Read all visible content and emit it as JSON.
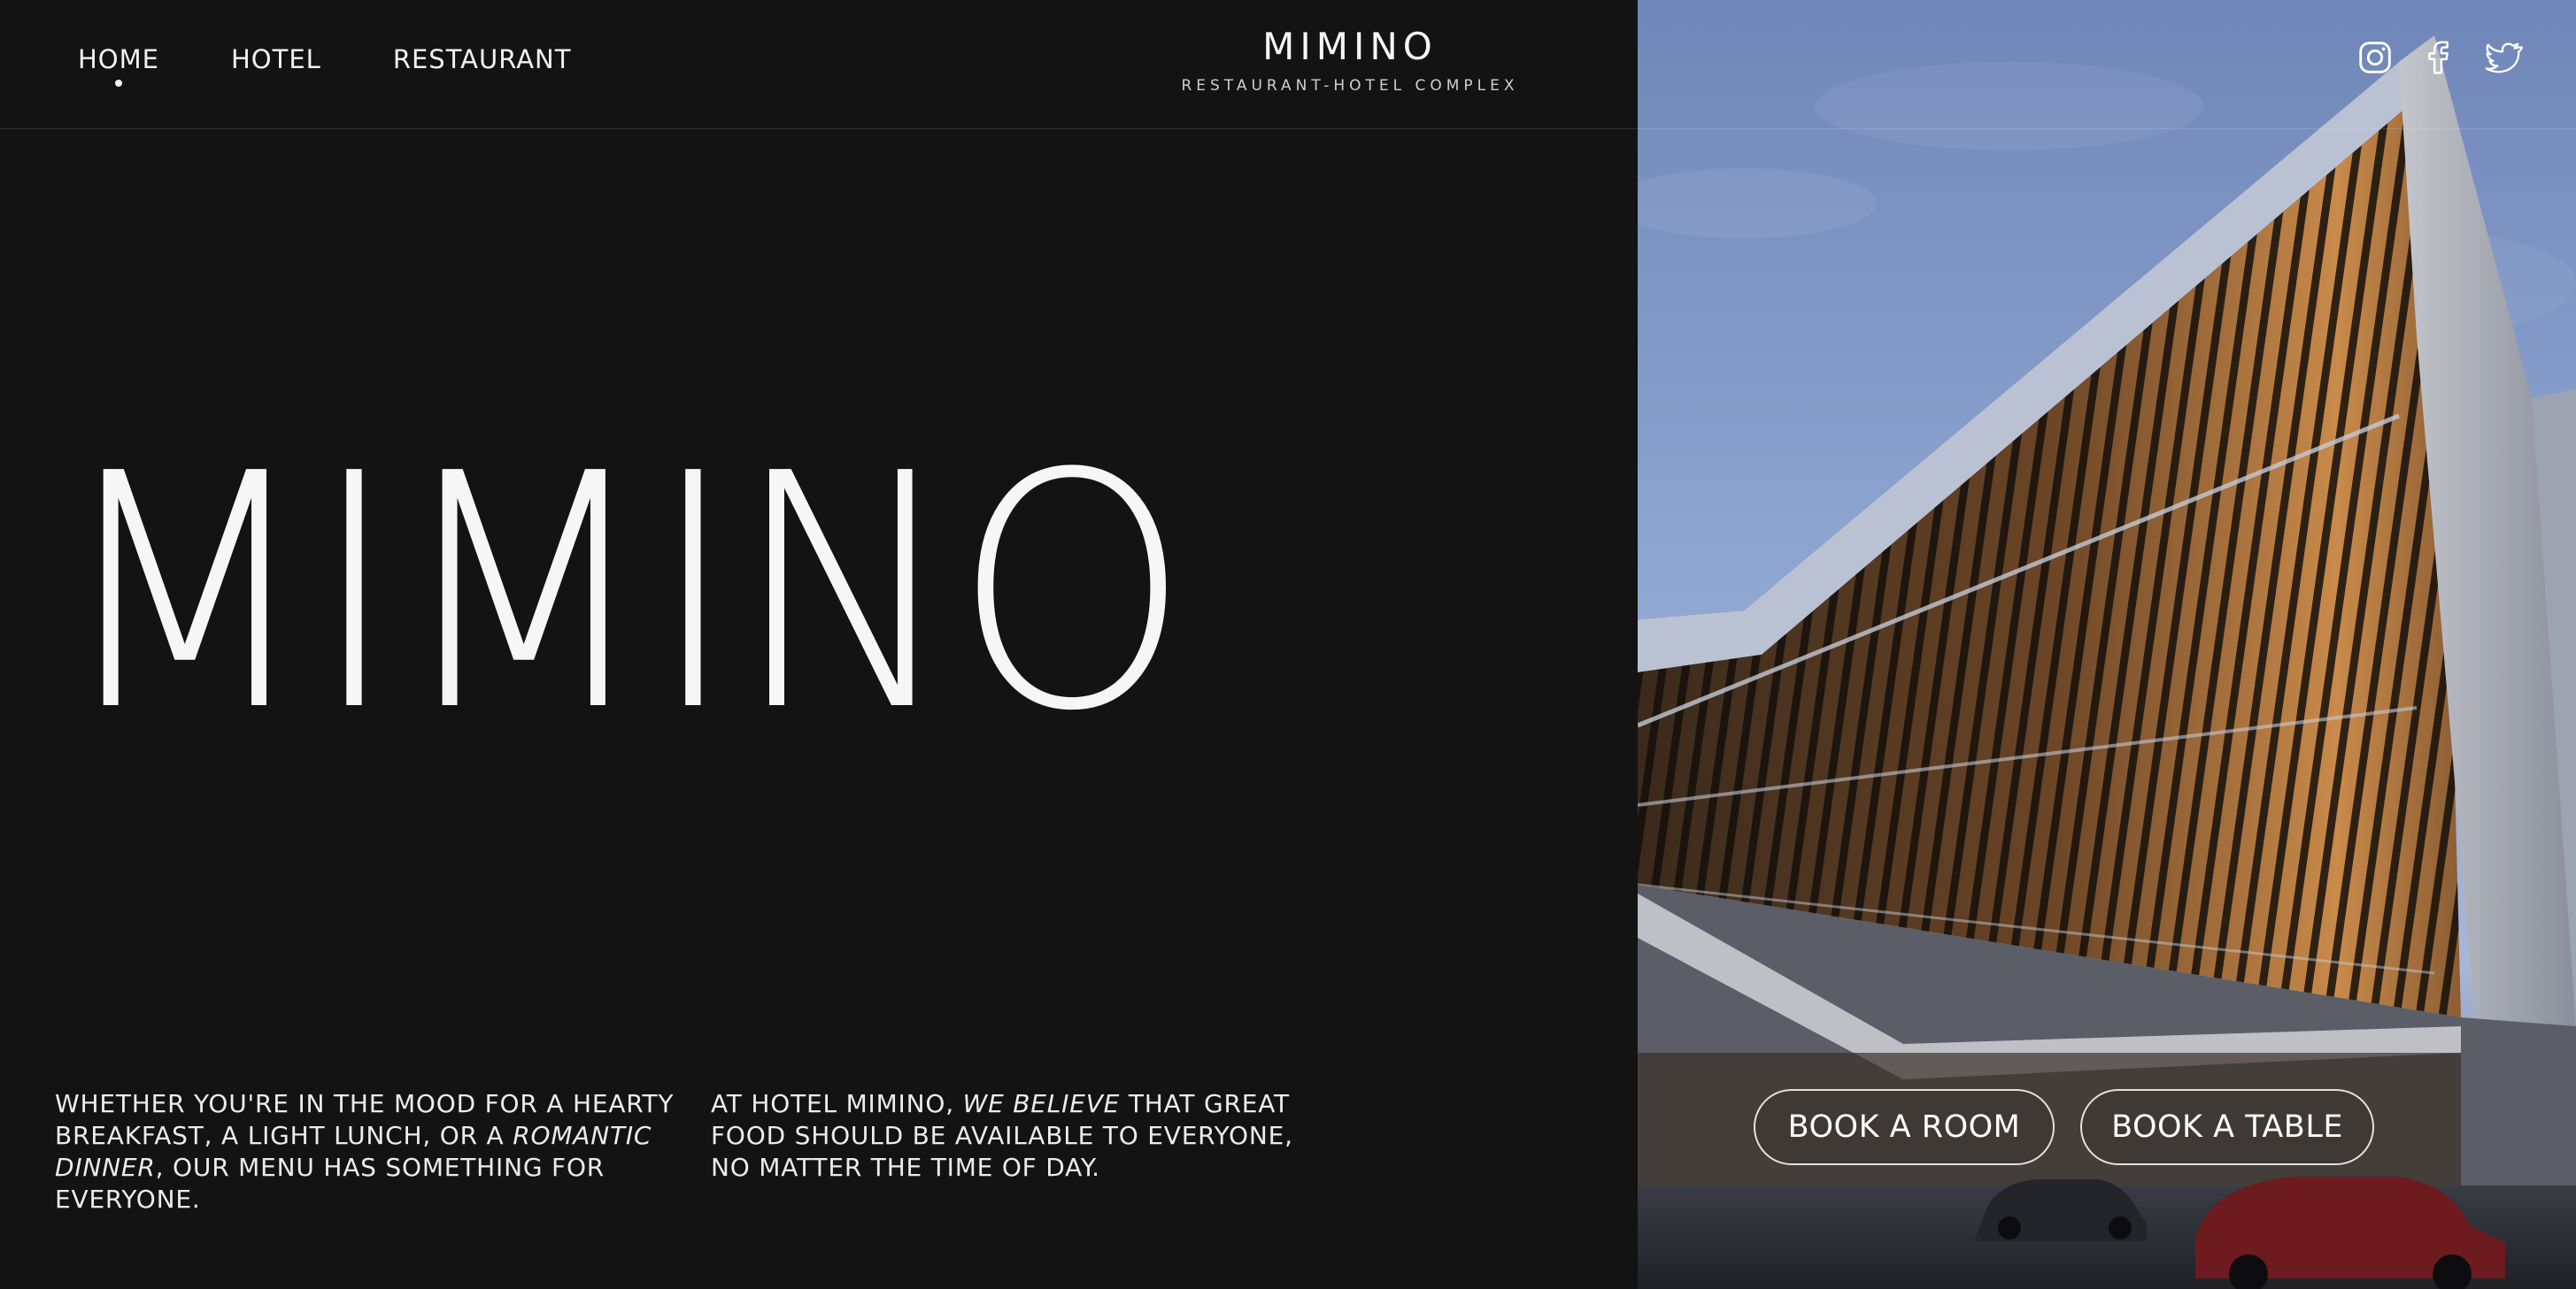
{
  "nav": {
    "items": [
      {
        "label": "HOME",
        "active": true
      },
      {
        "label": "HOTEL",
        "active": false
      },
      {
        "label": "RESTAURANT",
        "active": false
      }
    ]
  },
  "brand": {
    "name": "MIMINO",
    "tagline": "RESTAURANT-HOTEL COMPLEX"
  },
  "hero": {
    "title": "MIMINO"
  },
  "copy": {
    "left": {
      "part1": "WHETHER YOU'RE IN THE MOOD FOR A HEARTY BREAKFAST, A LIGHT LUNCH, OR A ",
      "em": "ROMANTIC DINNER",
      "part2": ", OUR MENU HAS SOMETHING FOR EVERYONE."
    },
    "right": {
      "part1": "AT HOTEL MIMINO, ",
      "em": "WE BELIEVE",
      "part2": " THAT GREAT FOOD SHOULD BE AVAILABLE TO EVERYONE, NO MATTER THE TIME OF DAY."
    }
  },
  "social": [
    "instagram-icon",
    "facebook-icon",
    "twitter-icon"
  ],
  "cta": {
    "book_room": "BOOK A ROOM",
    "book_table": "BOOK A TABLE"
  },
  "colors": {
    "background": "#131313",
    "text": "#f4f4f4",
    "sky": "#7c93c4",
    "glow": "#c98a4a"
  }
}
